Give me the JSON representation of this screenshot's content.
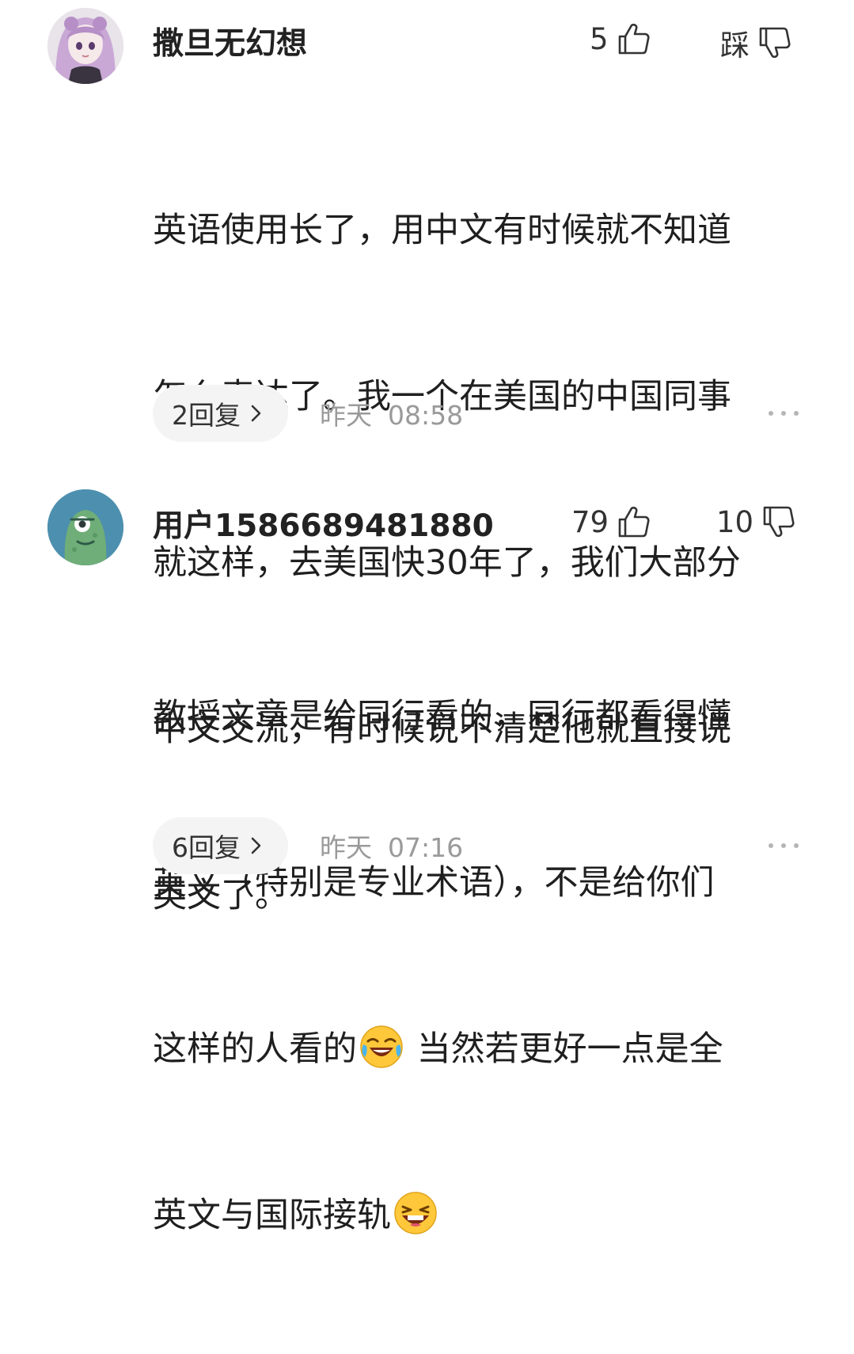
{
  "comments": [
    {
      "username": "撒旦无幻想",
      "likes": "5",
      "dislike_label": "踩",
      "content_lines": [
        "英语使用长了，用中文有时候就不知道",
        "怎么表达了。我一个在美国的中国同事",
        "就这样，去美国快30年了，我们大部分",
        "中文交流，有时候说不清楚他就直接说",
        "英文了。"
      ],
      "reply_label": "2回复",
      "time_day": "昨天",
      "time_clock": "08:58"
    },
    {
      "username": "用户1586689481880",
      "likes": "79",
      "dislikes": "10",
      "content_lines": [
        "教授文章是给同行看的，同行都看得懂",
        "英文（特别是专业术语），不是给你们"
      ],
      "line3_before": "这样的人看的",
      "line3_after": " 当然若更好一点是全",
      "line4_before": "英文与国际接轨",
      "emoji_1": "laughing-crying-emoji",
      "emoji_2": "grinning-emoji",
      "reply_label": "6回复",
      "time_day": "昨天",
      "time_clock": "07:16"
    }
  ],
  "icons": {
    "like": "thumbs-up-icon",
    "dislike": "thumbs-down-icon",
    "more": "more-dots-icon",
    "chevron": "chevron-right-icon"
  },
  "colors": {
    "text": "#1f1f1f",
    "muted": "#9a9a9a",
    "reply_bg": "#f4f4f4"
  }
}
